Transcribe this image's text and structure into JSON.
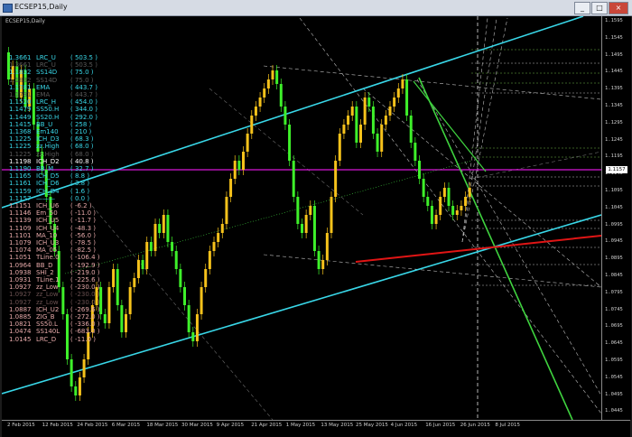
{
  "window": {
    "title": "ECSEP15,Daily",
    "minimize": "_",
    "maximize": "□",
    "close": "×"
  },
  "chart": {
    "label": "ECSEP15,Daily",
    "current_price": "1.1157"
  },
  "colors": {
    "bull": "#f6c21b",
    "bear": "#3ef02a",
    "channel": "#39d7e8",
    "green_line": "#3fd33f",
    "red_line": "#e01515",
    "magenta": "#d817d8"
  },
  "legend": [
    {
      "value": "1.3661",
      "name": "LRC_U",
      "val": "( 503.5 )",
      "color": "#39d7e8"
    },
    {
      "value": "1.3661",
      "name": "LRC_U",
      "val": "( 503.5 )",
      "color": "#5a5a5a"
    },
    {
      "value": "1.1832",
      "name": "SS14D",
      "val": "( 75.0 )",
      "color": "#39d7e8"
    },
    {
      "value": "1.1832",
      "name": "SS14D",
      "val": "( 75.0 )",
      "color": "#5a5a5a"
    },
    {
      "value": "1.1781",
      "name": "EMA",
      "val": "( 443.7 )",
      "color": "#39d7e8"
    },
    {
      "value": "1.1781",
      "name": "EMA",
      "val": "( 443.7 )",
      "color": "#5a5a5a"
    },
    {
      "value": "1.1520",
      "name": "LRC_H",
      "val": "( 454.0 )",
      "color": "#39d7e8"
    },
    {
      "value": "1.1479",
      "name": "SS50.H",
      "val": "( 344.0 )",
      "color": "#39d7e8"
    },
    {
      "value": "1.1449",
      "name": "SS20.H",
      "val": "( 292.0 )",
      "color": "#39d7e8"
    },
    {
      "value": "1.1415",
      "name": "BB_U",
      "val": "( 258 )",
      "color": "#39d7e8"
    },
    {
      "value": "1.1368",
      "name": "Em140",
      "val": "( 210 )",
      "color": "#39d7e8"
    },
    {
      "value": "1.1225",
      "name": "ICH_D3",
      "val": "( 68.3 )",
      "color": "#39d7e8"
    },
    {
      "value": "1.1225",
      "name": "zz.High",
      "val": "( 68.0 )",
      "color": "#39d7e8"
    },
    {
      "value": "1.1225",
      "name": "zz.High",
      "val": "( 68.0 )",
      "color": "#5a5a5a"
    },
    {
      "value": "1.1198",
      "name": "ICH_D2",
      "val": "( 40.8 )",
      "color": "#ffffff"
    },
    {
      "value": "1.1190",
      "name": "BB_M",
      "val": "( 32.7 )",
      "color": "#39d7e8"
    },
    {
      "value": "1.1165",
      "name": "ICH_D5",
      "val": "( 8.8 )",
      "color": "#39d7e8"
    },
    {
      "value": "1.1161",
      "name": "ICH_D6",
      "val": "( 3.8 )",
      "color": "#39d7e8"
    },
    {
      "value": "1.1159",
      "name": "ICH_D4",
      "val": "( 1.6 )",
      "color": "#39d7e8"
    },
    {
      "value": "1.1157",
      "name": "———",
      "val": "( 0.0 )",
      "color": "#39d7e8"
    },
    {
      "value": "1.1151",
      "name": "ICH_U6",
      "val": "( -6.2 )",
      "color": "#e6a9a9"
    },
    {
      "value": "1.1146",
      "name": "Em_50",
      "val": "( -11.0 )",
      "color": "#e6a9a9"
    },
    {
      "value": "1.1139",
      "name": "ICH_U5",
      "val": "( -11.7 )",
      "color": "#e6a9a9"
    },
    {
      "value": "1.1109",
      "name": "ICH_U4",
      "val": "( -48.3 )",
      "color": "#e6a9a9"
    },
    {
      "value": "1.1101",
      "name": "MA_10",
      "val": "( -56.0 )",
      "color": "#e6a9a9"
    },
    {
      "value": "1.1079",
      "name": "ICH_U3",
      "val": "( -78.5 )",
      "color": "#e6a9a9"
    },
    {
      "value": "1.1074",
      "name": "MA_05",
      "val": "( -82.5 )",
      "color": "#e6a9a9"
    },
    {
      "value": "1.1051",
      "name": "TLine.0",
      "val": "( -106.4 )",
      "color": "#e6a9a9"
    },
    {
      "value": "1.0964",
      "name": "BB_D",
      "val": "( -192.9 )",
      "color": "#e6a9a9"
    },
    {
      "value": "1.0938",
      "name": "SHI_2",
      "val": "( -219.0 )",
      "color": "#e6a9a9"
    },
    {
      "value": "1.0931",
      "name": "TLine.1",
      "val": "( -225.6 )",
      "color": "#e6a9a9"
    },
    {
      "value": "1.0927",
      "name": "zz_Low",
      "val": "( -230.0 )",
      "color": "#e6a9a9"
    },
    {
      "value": "1.0927",
      "name": "zz_Low",
      "val": "( -230.0 )",
      "color": "#6a5050"
    },
    {
      "value": "1.0927",
      "name": "zz_Low",
      "val": "( -230.0 )",
      "color": "#6a5050"
    },
    {
      "value": "1.0887",
      "name": "ICH_U2",
      "val": "( -269.6 )",
      "color": "#e6a9a9"
    },
    {
      "value": "1.0885",
      "name": "ZIG_B",
      "val": "( -272.0 )",
      "color": "#e6a9a9"
    },
    {
      "value": "1.0821",
      "name": "SS50.L",
      "val": "( -336.0 )",
      "color": "#e6a9a9"
    },
    {
      "value": "1.0474",
      "name": "SS140L",
      "val": "( -683.0 )",
      "color": "#e6a9a9"
    },
    {
      "value": "1.0145",
      "name": "LRC_D",
      "val": "( -11.0 )",
      "color": "#e6a9a9"
    }
  ],
  "y_axis": [
    "1.1595",
    "1.1545",
    "1.1495",
    "1.1445",
    "1.1395",
    "1.1345",
    "1.1295",
    "1.1245",
    "1.1195",
    "1.1145",
    "1.1095",
    "1.1045",
    "1.0995",
    "1.0945",
    "1.0895",
    "1.0845",
    "1.0795",
    "1.0745",
    "1.0695",
    "1.0645",
    "1.0595",
    "1.0545",
    "1.0495",
    "1.0445"
  ],
  "x_axis": [
    "2 Feb 2015",
    "12 Feb 2015",
    "24 Feb 2015",
    "6 Mar 2015",
    "18 Mar 2015",
    "30 Mar 2015",
    "9 Apr 2015",
    "21 Apr 2015",
    "1 May 2015",
    "13 May 2015",
    "25 May 2015",
    "4 Jun 2015",
    "16 Jun 2015",
    "26 Jun 2015",
    "8 Jul 2015"
  ]
}
